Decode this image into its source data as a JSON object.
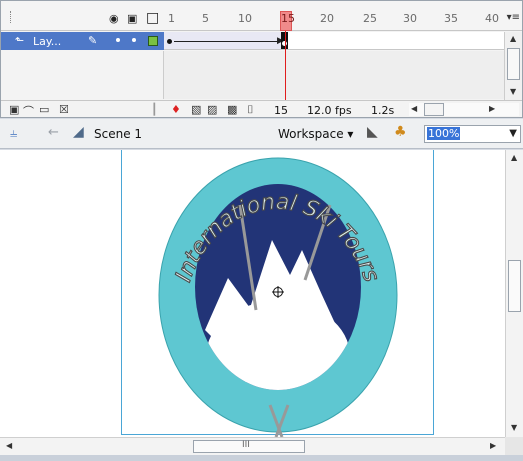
{
  "timeline": {
    "ruler_labels": [
      "1",
      "5",
      "10",
      "15",
      "20",
      "25",
      "30",
      "35",
      "40"
    ],
    "current_frame_marker": "15",
    "menu_icon": "panel-menu-icon",
    "header_icons": [
      "eye-icon",
      "lock-icon",
      "outline-icon"
    ],
    "layer": {
      "name": "Lay...",
      "visible_dot": "•",
      "locked_dot": "•"
    },
    "status": {
      "frame": "15",
      "fps": "12.0 fps",
      "time": "1.2s"
    }
  },
  "editbar": {
    "scene_label": "Scene 1",
    "workspace_label": "Workspace ▾",
    "zoom_value": "100%"
  },
  "stage": {
    "logo_text": "International Ski Tours",
    "colors": {
      "ring": "#5ec7d1",
      "ring_dark": "#3aa3ad",
      "mountain_bg": "#223477",
      "snow": "#ffffff",
      "text_fill": "#dff2f4",
      "text_stroke": "#4a4a4a",
      "doc_border": "#4aa6d6"
    }
  },
  "scrollbars": {
    "grip": "III"
  }
}
